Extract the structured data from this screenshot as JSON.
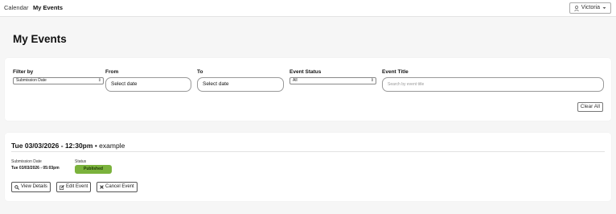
{
  "nav": {
    "items": [
      {
        "label": "Calendar"
      },
      {
        "label": "My Events"
      }
    ],
    "user_label": "Victoria"
  },
  "page_title": "My Events",
  "filters": {
    "filter_by": {
      "label": "Filter by",
      "value": "Submission Date"
    },
    "from": {
      "label": "From",
      "value": "Select date"
    },
    "to": {
      "label": "To",
      "value": "Select date"
    },
    "status": {
      "label": "Event Status",
      "value": "All"
    },
    "title": {
      "label": "Event Title",
      "placeholder": "Search by event title"
    },
    "clear_label": "Clear All"
  },
  "events": [
    {
      "date_time": "Tue 03/03/2026 - 12:30pm",
      "separator": "•",
      "name": "example",
      "submission_label": "Submission Date",
      "submission_value": "Tue 03/03/2026 - 05:03pm",
      "status_label": "Status",
      "status_value": "Published",
      "actions": {
        "view": "View Details",
        "edit": "Edit Event",
        "cancel": "Cancel Event"
      }
    }
  ],
  "colors": {
    "published": "#7bb23c",
    "background": "#f6f6f6"
  },
  "icons": {
    "user": "user-icon",
    "caret": "caret-down-icon",
    "view": "magnifier-icon",
    "edit": "pencil-square-icon",
    "cancel": "x-icon"
  }
}
